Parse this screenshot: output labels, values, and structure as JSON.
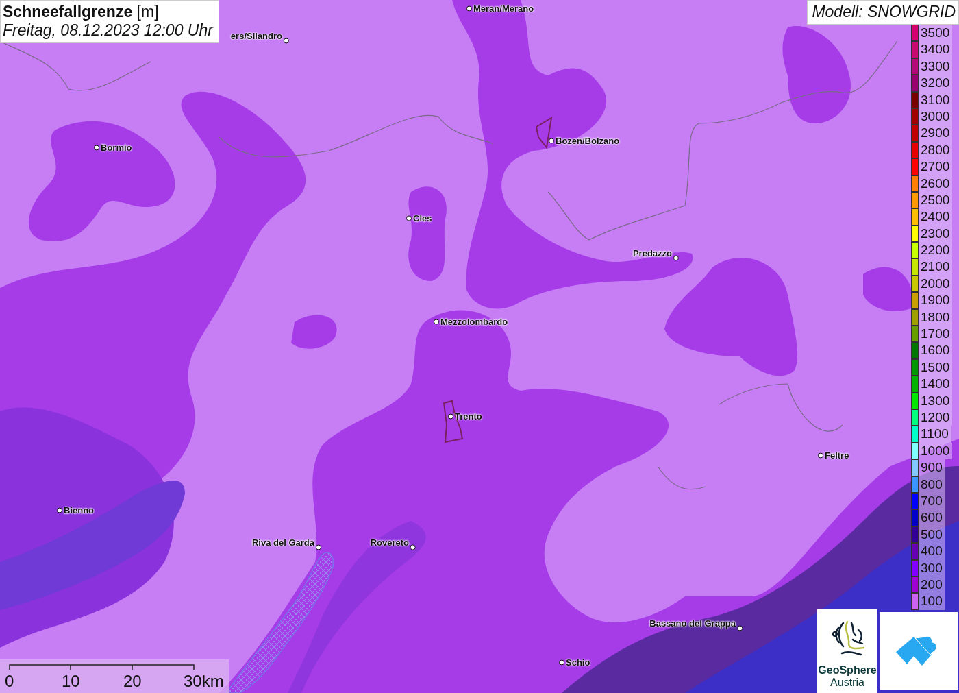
{
  "title": {
    "heading": "**Schneefallgrenze** [m]",
    "datetime": "Freitag, 08.12.2023 12:00 Uhr"
  },
  "model": "Modell: SNOWGRID",
  "legend": [
    {
      "label": "3500",
      "color": "#d2006e"
    },
    {
      "label": "3400",
      "color": "#c80a6e"
    },
    {
      "label": "3300",
      "color": "#b40a78"
    },
    {
      "label": "3200",
      "color": "#96006e"
    },
    {
      "label": "3100",
      "color": "#780000"
    },
    {
      "label": "3000",
      "color": "#a00000"
    },
    {
      "label": "2900",
      "color": "#c00000"
    },
    {
      "label": "2800",
      "color": "#e60000"
    },
    {
      "label": "2700",
      "color": "#ff0000"
    },
    {
      "label": "2600",
      "color": "#ff8000"
    },
    {
      "label": "2500",
      "color": "#ff9a00"
    },
    {
      "label": "2400",
      "color": "#ffbe00"
    },
    {
      "label": "2300",
      "color": "#ffff00"
    },
    {
      "label": "2200",
      "color": "#c8ff00"
    },
    {
      "label": "2100",
      "color": "#c8e600"
    },
    {
      "label": "2000",
      "color": "#c8c800"
    },
    {
      "label": "1900",
      "color": "#c8a000"
    },
    {
      "label": "1800",
      "color": "#a0a000"
    },
    {
      "label": "1700",
      "color": "#64a000"
    },
    {
      "label": "1600",
      "color": "#007800"
    },
    {
      "label": "1500",
      "color": "#009600"
    },
    {
      "label": "1400",
      "color": "#00b400"
    },
    {
      "label": "1300",
      "color": "#00e600"
    },
    {
      "label": "1200",
      "color": "#00ff80"
    },
    {
      "label": "1100",
      "color": "#00ffc8"
    },
    {
      "label": "1000",
      "color": "#80ffff"
    },
    {
      "label": "900",
      "color": "#80c8ff"
    },
    {
      "label": "800",
      "color": "#3c96ff"
    },
    {
      "label": "700",
      "color": "#0000ff"
    },
    {
      "label": "600",
      "color": "#0000c8"
    },
    {
      "label": "500",
      "color": "#320096"
    },
    {
      "label": "400",
      "color": "#6400b4"
    },
    {
      "label": "300",
      "color": "#8200ff"
    },
    {
      "label": "200",
      "color": "#a000d2"
    },
    {
      "label": "100",
      "color": "#c864f0"
    }
  ],
  "cities": [
    {
      "name": "Meran/Merano"
    },
    {
      "name": "ers/Silandro"
    },
    {
      "name": "Bormio"
    },
    {
      "name": "Bozen/Bolzano"
    },
    {
      "name": "Cles"
    },
    {
      "name": "Predazzo"
    },
    {
      "name": "Mezzolombardo"
    },
    {
      "name": "Trento"
    },
    {
      "name": "Feltre"
    },
    {
      "name": "Bienno"
    },
    {
      "name": "Riva del Garda"
    },
    {
      "name": "Rovereto"
    },
    {
      "name": "Bassano del Grappa"
    },
    {
      "name": "Schio"
    }
  ],
  "scale_bar": [
    "0",
    "10",
    "20",
    "30km"
  ],
  "logos": {
    "geosphere": [
      "GeoSphere",
      "Austria"
    ]
  }
}
